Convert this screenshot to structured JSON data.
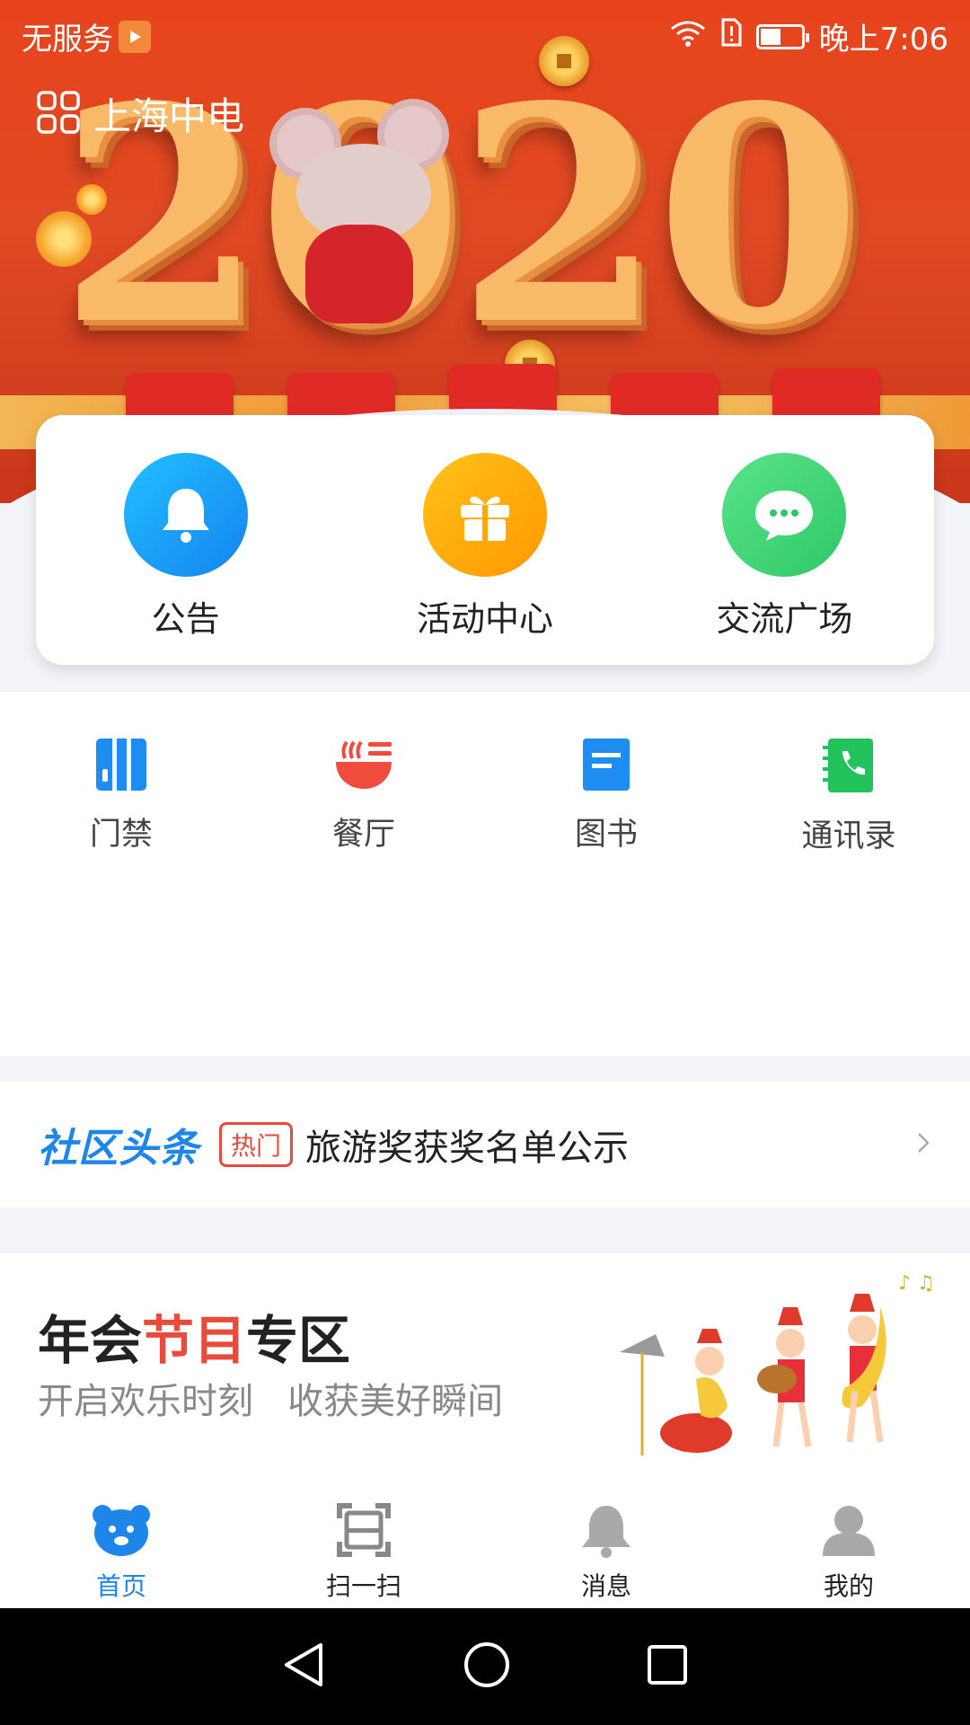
{
  "status_bar": {
    "carrier": "无服务",
    "time": "晚上7:06"
  },
  "header": {
    "title": "上海中电",
    "banner_year": "2020"
  },
  "quick_actions": [
    {
      "label": "公告",
      "icon": "bell-icon",
      "color": "#1e9bf0"
    },
    {
      "label": "活动中心",
      "icon": "gift-icon",
      "color": "#ffa800"
    },
    {
      "label": "交流广场",
      "icon": "chat-icon",
      "color": "#3fcf72"
    }
  ],
  "services": [
    {
      "label": "门禁",
      "icon": "door-icon",
      "color": "#1e8cf0"
    },
    {
      "label": "餐厅",
      "icon": "bowl-icon",
      "color": "#f04b3c"
    },
    {
      "label": "图书",
      "icon": "book-icon",
      "color": "#1e8cf0"
    },
    {
      "label": "通讯录",
      "icon": "phonebook-icon",
      "color": "#22c25c"
    }
  ],
  "news": {
    "brand": "社区头条",
    "tag": "热门",
    "headline": "旅游奖获奖名单公示"
  },
  "annual": {
    "title_a": "年会",
    "title_b": "节目",
    "title_c": "专区",
    "subtitle": "开启欢乐时刻   收获美好瞬间"
  },
  "tabs": [
    {
      "label": "首页",
      "icon": "bear-home-icon",
      "active": true
    },
    {
      "label": "扫一扫",
      "icon": "scan-icon",
      "active": false
    },
    {
      "label": "消息",
      "icon": "bell-icon",
      "active": false
    },
    {
      "label": "我的",
      "icon": "person-icon",
      "active": false
    }
  ],
  "colors": {
    "accent": "#1e86e8",
    "banner_red": "#e8441c",
    "hot_red": "#e84b3c"
  }
}
